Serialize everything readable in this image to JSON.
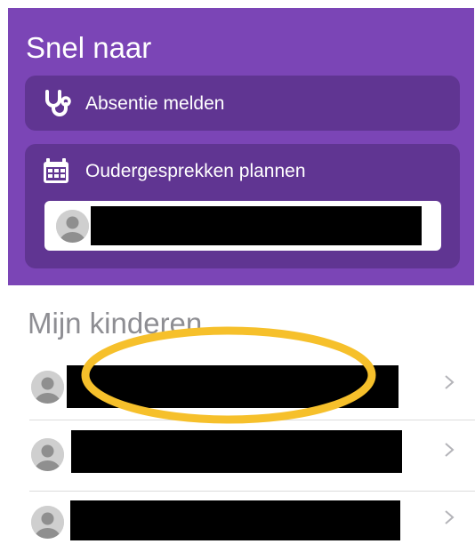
{
  "quick_actions": {
    "title": "Snel naar",
    "absence": {
      "label": "Absentie melden",
      "icon": "stethoscope-icon"
    },
    "meetings": {
      "label": "Oudergesprekken plannen",
      "icon": "calendar-icon"
    }
  },
  "children": {
    "title": "Mijn kinderen",
    "items": [
      {
        "avatar": "person-avatar"
      },
      {
        "avatar": "person-avatar"
      },
      {
        "avatar": "person-avatar"
      }
    ]
  },
  "colors": {
    "brand_purple": "#7b45b6",
    "tile_purple": "#603592",
    "highlight_yellow": "#f6c02b",
    "chevron": "#b4b4b9"
  }
}
